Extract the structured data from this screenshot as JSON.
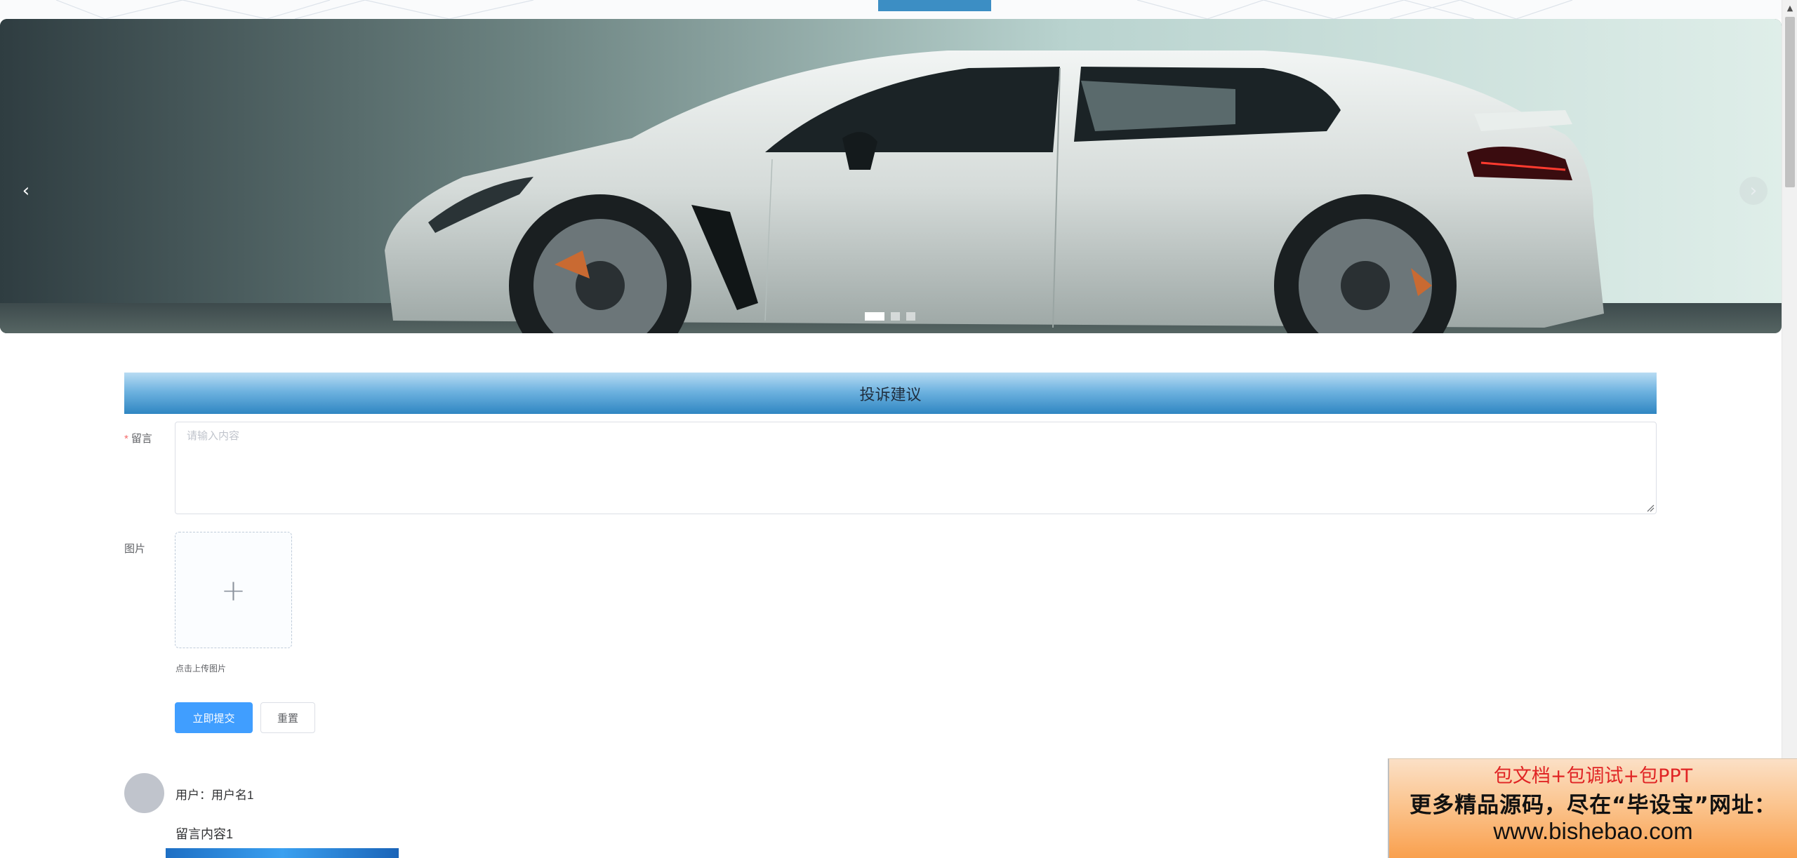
{
  "carousel": {
    "prev_icon": "chevron-left-icon",
    "next_icon": "chevron-right-icon",
    "prev_glyph": "‹",
    "next_glyph": "›",
    "slide_count": 3,
    "active_index": 0
  },
  "section": {
    "title": "投诉建议"
  },
  "form": {
    "message_label": "留言",
    "message_required_mark": "*",
    "message_placeholder": "请输入内容",
    "message_value": "",
    "image_label": "图片",
    "upload_icon": "plus-icon",
    "upload_glyph": "+",
    "upload_hint": "点击上传图片",
    "submit_label": "立即提交",
    "reset_label": "重置"
  },
  "comments": [
    {
      "user_line": "用户：用户名1",
      "content": "留言内容1"
    }
  ],
  "ad": {
    "line1": "包文档+包调试+包PPT",
    "line2": "更多精品源码，尽在“毕设宝”网址：",
    "line3": "www.bishebao.com"
  },
  "colors": {
    "primary": "#409eff",
    "header_gradient_top": "#b8dcf3",
    "header_gradient_bottom": "#2f86c2",
    "required": "#f56c6c",
    "ad_red": "#e02424"
  }
}
